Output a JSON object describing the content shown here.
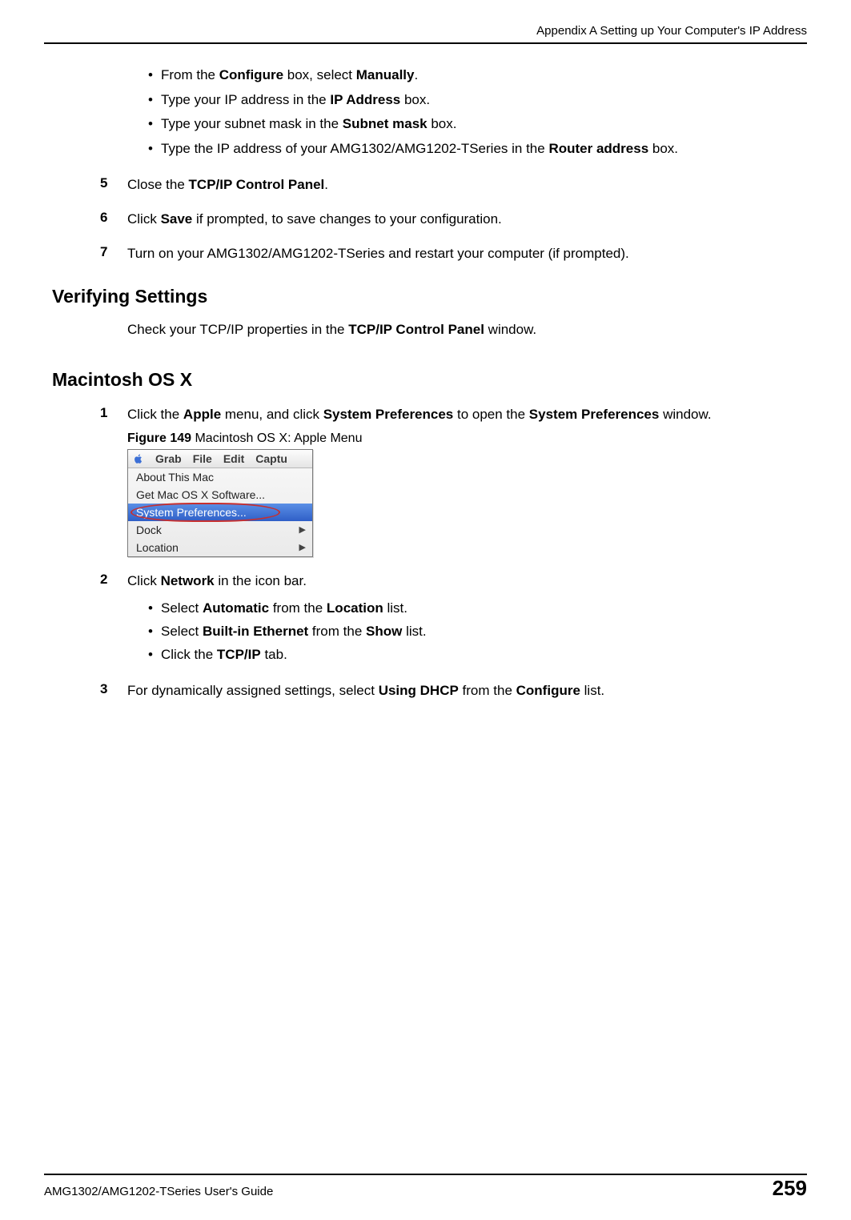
{
  "header": {
    "running_head": "Appendix A Setting up Your Computer's IP Address"
  },
  "bullets_top": [
    {
      "pre": "From the ",
      "b1": "Configure",
      "mid1": " box, select ",
      "b2": "Manually",
      "post": "."
    },
    {
      "pre": "Type your IP address in the ",
      "b1": "IP Address",
      "mid1": " box.",
      "b2": "",
      "post": ""
    },
    {
      "pre": "Type your subnet mask in the ",
      "b1": "Subnet mask",
      "mid1": " box.",
      "b2": "",
      "post": ""
    },
    {
      "pre": "Type the IP address of your AMG1302/AMG1202-TSeries in the ",
      "b1": "Router address",
      "mid1": " box.",
      "b2": "",
      "post": ""
    }
  ],
  "steps_a": [
    {
      "n": "5",
      "pre": "Close the ",
      "b1": "TCP/IP Control Panel",
      "post": "."
    },
    {
      "n": "6",
      "pre": "Click ",
      "b1": "Save",
      "post": " if prompted, to save changes to your configuration."
    },
    {
      "n": "7",
      "pre": "Turn on your AMG1302/AMG1202-TSeries and restart your computer (if prompted).",
      "b1": "",
      "post": ""
    }
  ],
  "h_verify": "Verifying Settings",
  "verify_para": {
    "pre": "Check your TCP/IP properties in the ",
    "b1": "TCP/IP Control Panel",
    "post": " window."
  },
  "h_osx": "Macintosh OS X",
  "osx_step1": {
    "n": "1",
    "pre": "Click the ",
    "b1": "Apple",
    "mid1": " menu, and click ",
    "b2": "System Preferences",
    "mid2": " to open the ",
    "b3": "System Preferences",
    "post": " window."
  },
  "figure": {
    "label": "Figure 149",
    "caption": "   Macintosh OS X: Apple Menu"
  },
  "apple_menu": {
    "menubar": [
      "Grab",
      "File",
      "Edit",
      "Captu"
    ],
    "items": [
      {
        "label": "About This Mac",
        "arrow": false,
        "selected": false
      },
      {
        "label": "Get Mac OS X Software...",
        "arrow": false,
        "selected": false
      },
      {
        "label": "System Preferences...",
        "arrow": false,
        "selected": true
      },
      {
        "label": "Dock",
        "arrow": true,
        "selected": false
      },
      {
        "label": "Location",
        "arrow": true,
        "selected": false
      }
    ]
  },
  "osx_step2": {
    "n": "2",
    "pre": "Click ",
    "b1": "Network",
    "post": " in the icon bar."
  },
  "osx_step2_bullets": [
    {
      "pre": "Select ",
      "b1": "Automatic",
      "mid": " from the ",
      "b2": "Location",
      "post": " list."
    },
    {
      "pre": "Select ",
      "b1": "Built-in Ethernet",
      "mid": " from the ",
      "b2": "Show",
      "post": " list."
    },
    {
      "pre": "Click the ",
      "b1": "TCP/IP",
      "mid": " tab.",
      "b2": "",
      "post": ""
    }
  ],
  "osx_step3": {
    "n": "3",
    "pre": "For dynamically assigned settings, select ",
    "b1": "Using DHCP",
    "mid": " from the ",
    "b2": "Configure",
    "post": " list."
  },
  "footer": {
    "guide": "AMG1302/AMG1202-TSeries User's Guide",
    "page": "259"
  }
}
